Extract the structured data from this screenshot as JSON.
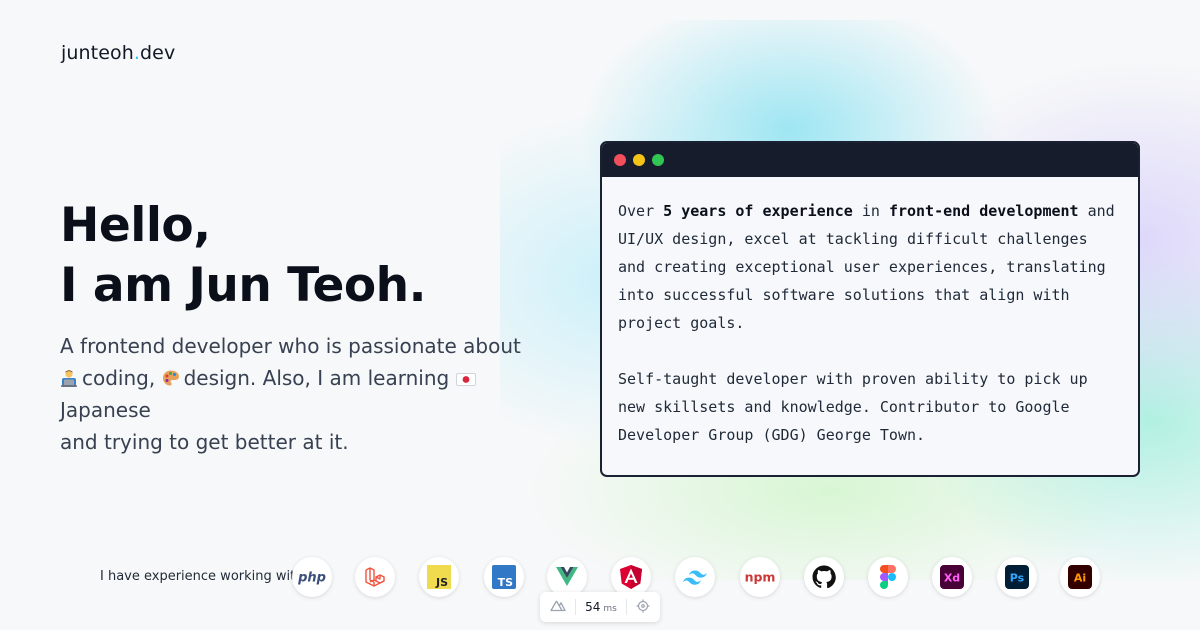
{
  "brand": {
    "name_main": "junteoh",
    "name_dot": ".",
    "name_tld": "dev",
    "dot_color": "#38bdf8"
  },
  "hero": {
    "title_line1": "Hello,",
    "title_line2": "I am Jun Teoh.",
    "subtitle_part1": "A frontend developer who is passionate about",
    "coding_emoji": "technologist-icon",
    "coding_text": "coding,",
    "design_emoji": "artist-palette-icon",
    "design_text": "design. Also, I am learning",
    "japan_emoji": "japan-flag-icon",
    "japanese_text": "Japanese",
    "subtitle_part2": "and trying to get better at it."
  },
  "terminal": {
    "p1_pre": "Over ",
    "p1_bold1": "5 years of experience",
    "p1_mid": " in ",
    "p1_bold2": "front-end development",
    "p1_post": " and UI/UX design, excel at tackling difficult challenges and creating exceptional user experiences, translating into successful software solutions that align with project goals.",
    "p2": "Self-taught developer with proven ability to pick up new skillsets and knowledge. Contributor to Google Developer Group (GDG) George Town."
  },
  "skills": {
    "label": "I have experience working with",
    "items": [
      {
        "name": "php",
        "icon": "php-icon"
      },
      {
        "name": "laravel",
        "icon": "laravel-icon"
      },
      {
        "name": "JS",
        "icon": "javascript-icon"
      },
      {
        "name": "TS",
        "icon": "typescript-icon"
      },
      {
        "name": "vue",
        "icon": "vue-icon"
      },
      {
        "name": "angular",
        "icon": "angular-icon"
      },
      {
        "name": "tailwind",
        "icon": "tailwind-icon"
      },
      {
        "name": "npm",
        "icon": "npm-icon"
      },
      {
        "name": "github",
        "icon": "github-icon"
      },
      {
        "name": "figma",
        "icon": "figma-icon"
      },
      {
        "name": "Xd",
        "icon": "adobe-xd-icon"
      },
      {
        "name": "Ps",
        "icon": "photoshop-icon"
      },
      {
        "name": "Ai",
        "icon": "illustrator-icon"
      }
    ]
  },
  "perf_widget": {
    "value": "54",
    "unit": "ms",
    "logo_icon": "nuxt-icon",
    "target_icon": "crosshair-icon"
  }
}
